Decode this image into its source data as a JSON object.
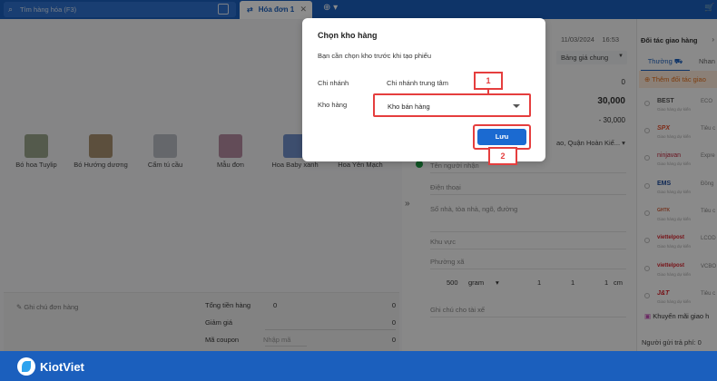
{
  "topbar": {
    "search_placeholder": "Tìm hàng hóa (F3)",
    "tab_label": "Hóa đơn 1",
    "add_tab_glyph": "⊕ ▾"
  },
  "products": [
    {
      "name": "Bó hoa Tuylip",
      "color": "#9aa58a"
    },
    {
      "name": "Bó Hướng dương",
      "color": "#a89070"
    },
    {
      "name": "Cẩm tú cầu",
      "color": "#b9bcc4"
    },
    {
      "name": "Mẫu đơn",
      "color": "#b58aa0"
    },
    {
      "name": "Hoa Baby xanh",
      "color": "#6f8fc8"
    },
    {
      "name": "Hoa Yên Mạch",
      "color": "#c9c9c9"
    }
  ],
  "order_summary": {
    "note_label": "Ghi chú đơn hàng",
    "total_label": "Tổng tiền hàng",
    "total_count": "0",
    "total_value": "0",
    "discount_label": "Giảm giá",
    "discount_value": "0",
    "coupon_label": "Mã coupon",
    "coupon_placeholder": "Nhập mã",
    "coupon_value": "0"
  },
  "right_panel": {
    "date": "11/03/2024",
    "time": "16:53",
    "price_book": "Bảng giá chung",
    "value_1": "0",
    "value_2": "30,000",
    "value_3": "- 30,000",
    "address_fragment": "ao, Quận Hoàn Kiế...",
    "receiver_placeholder": "Tên người nhận",
    "phone_placeholder": "Điện thoại",
    "street_placeholder": "Số nhà, tòa nhà, ngõ, đường",
    "area_placeholder": "Khu vực",
    "ward_placeholder": "Phường xã",
    "weight": "500",
    "weight_unit": "gram",
    "dim_1": "1",
    "dim_2": "1",
    "dim_3": "1",
    "dim_unit": "cm",
    "driver_note_placeholder": "Ghi chú cho tài xế"
  },
  "partner_panel": {
    "title": "Đối tác giao hàng",
    "tab_normal": "Thường",
    "tab_fast": "Nhan",
    "add_partner": "Thêm đối tác giao",
    "partners": [
      {
        "name": "BEST",
        "color": "#555555",
        "service": "ECO"
      },
      {
        "name": "SPX",
        "color": "#e8502d",
        "service": "Tiêu c"
      },
      {
        "name": "ninjavan",
        "color": "#c0243b",
        "service": "Expre"
      },
      {
        "name": "EMS",
        "color": "#1b4a9c",
        "service": "Đồng"
      },
      {
        "name": "GHTK",
        "color": "#d4603a",
        "service": "Tiêu c"
      },
      {
        "name": "viettelpost",
        "color": "#d9232d",
        "service": "LCOD"
      },
      {
        "name": "viettelpost",
        "color": "#d9232d",
        "service": "VCBO"
      },
      {
        "name": "J&T",
        "color": "#d9232d",
        "service": "Tiêu c"
      }
    ],
    "tiny_caption": "Giao hàng dự kiến",
    "promo_label": "Khuyến mãi giao h",
    "payer_label": "Người gửi trả phí:",
    "payer_value": "0"
  },
  "dialog": {
    "title": "Chọn kho hàng",
    "description": "Bạn cần chọn kho trước khi tạo phiếu",
    "branch_label": "Chi nhánh",
    "branch_value": "Chi nhánh trung tâm",
    "warehouse_label": "Kho hàng",
    "warehouse_value": "Kho bán hàng",
    "save_label": "Lưu"
  },
  "callouts": {
    "first": "1",
    "second": "2"
  },
  "footer": {
    "brand": "KiotViet"
  },
  "colors": {
    "brand_blue": "#1b5fbd",
    "callout_red": "#e53e3e",
    "save_blue": "#1b6ad1"
  }
}
